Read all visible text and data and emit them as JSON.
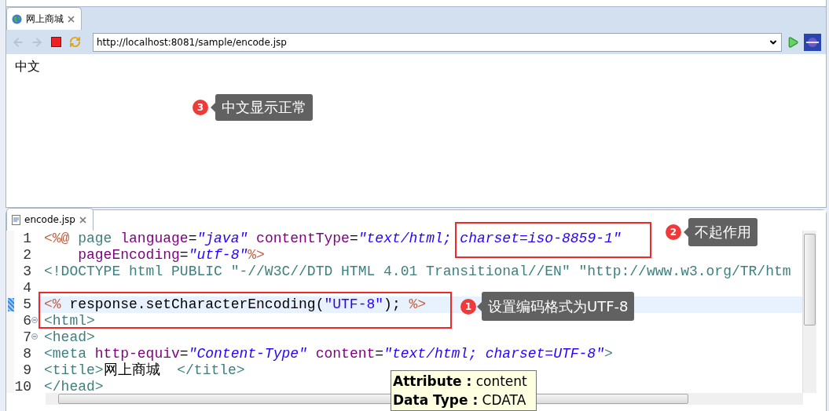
{
  "browser": {
    "tab": {
      "title": "网上商城",
      "selected": true
    },
    "toolbar": [
      {
        "kind": "back",
        "disabled": true
      },
      {
        "kind": "forward",
        "disabled": true
      },
      {
        "kind": "stop",
        "disabled": false
      },
      {
        "kind": "refresh",
        "disabled": false
      }
    ],
    "url": "http://localhost:8081/sample/encode.jsp",
    "content": "中文"
  },
  "editor": {
    "tab": {
      "title": "encode.jsp",
      "selected": true
    },
    "lines": [
      {
        "number": "1",
        "tokens": [
          {
            "kind": "delim",
            "text": "<%@ "
          },
          {
            "kind": "tag",
            "text": "page "
          },
          {
            "kind": "attr",
            "text": "language"
          },
          {
            "kind": "plain",
            "text": "="
          },
          {
            "kind": "value",
            "text": "\"java\" "
          },
          {
            "kind": "attr",
            "text": "contentType"
          },
          {
            "kind": "plain",
            "text": "="
          },
          {
            "kind": "value",
            "text": "\"text/html; charset=iso-8859-1\""
          }
        ]
      },
      {
        "number": "2",
        "tokens": [
          {
            "kind": "attr",
            "text": "    pageEncoding"
          },
          {
            "kind": "plain",
            "text": "="
          },
          {
            "kind": "value",
            "text": "\"utf-8\""
          },
          {
            "kind": "delim",
            "text": "%>"
          }
        ]
      },
      {
        "number": "3",
        "tokens": [
          {
            "kind": "tag",
            "text": "<!DOCTYPE html PUBLIC \"-//W3C//DTD HTML 4.01 Transitional//EN\" \"http://www.w3.org/TR/htm"
          }
        ]
      },
      {
        "number": "4"
      },
      {
        "number": "5",
        "current": true,
        "tokens": [
          {
            "kind": "delim",
            "text": "<% "
          },
          {
            "kind": "plain",
            "text": "response.setCharacterEncoding("
          },
          {
            "kind": "string",
            "text": "\"UTF-8\""
          },
          {
            "kind": "plain",
            "text": "); "
          },
          {
            "kind": "delim",
            "text": "%>"
          }
        ]
      },
      {
        "number": "6",
        "foldable": true,
        "tokens": [
          {
            "kind": "tag",
            "text": "<html>"
          }
        ]
      },
      {
        "number": "7",
        "foldable": true,
        "tokens": [
          {
            "kind": "tag",
            "text": "<head>"
          }
        ]
      },
      {
        "number": "8",
        "tokens": [
          {
            "kind": "tag",
            "text": "<meta "
          },
          {
            "kind": "attr",
            "text": "http-equiv"
          },
          {
            "kind": "plain",
            "text": "="
          },
          {
            "kind": "value",
            "text": "\"Content-Type\" "
          },
          {
            "kind": "attr",
            "text": "content"
          },
          {
            "kind": "plain",
            "text": "="
          },
          {
            "kind": "value",
            "text": "\"text/html; charset=UTF-8\""
          },
          {
            "kind": "tag",
            "text": ">"
          }
        ]
      },
      {
        "number": "9",
        "tokens": [
          {
            "kind": "tag",
            "text": "<title>"
          },
          {
            "kind": "plain",
            "text": "网上商城  "
          },
          {
            "kind": "tag",
            "text": "</title>"
          }
        ]
      },
      {
        "number": "10",
        "tokens": [
          {
            "kind": "tag",
            "text": "</head>"
          }
        ]
      }
    ],
    "tooltip": [
      "**Attribute :** content",
      "**Data Type :** CDATA"
    ]
  },
  "annotations": [
    {
      "number": "1",
      "text": "设置编码格式为UTF-8"
    },
    {
      "number": "2",
      "text": "不起作用"
    },
    {
      "number": "3",
      "text": "中文显示正常"
    }
  ]
}
